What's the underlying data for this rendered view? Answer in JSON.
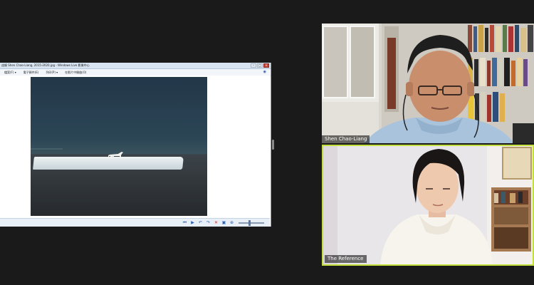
{
  "shared_window": {
    "title": "這條 Shen Chao-Liang, 2015-2020.jpg - Windows Live 影像中心",
    "controls": [
      "–",
      "□",
      "✕"
    ],
    "menu": [
      "檔案(F) ▾",
      "電子郵件(E)",
      "列印(P) ▾",
      "在影片中開啟(O)"
    ],
    "help_icon": "help-icon",
    "image_caption": "",
    "status_buttons": [
      "⏮",
      "▶",
      "↶",
      "↷",
      "✕",
      "▣",
      "⊕"
    ]
  },
  "participants": [
    {
      "name": "Shen Chao-Liang",
      "speaking": false
    },
    {
      "name": "The Reference",
      "speaking": true
    }
  ],
  "colors": {
    "background": "#1a1a1a",
    "active_speaker_border": "#c3df3e",
    "window_chrome": "#d8e4f2"
  }
}
